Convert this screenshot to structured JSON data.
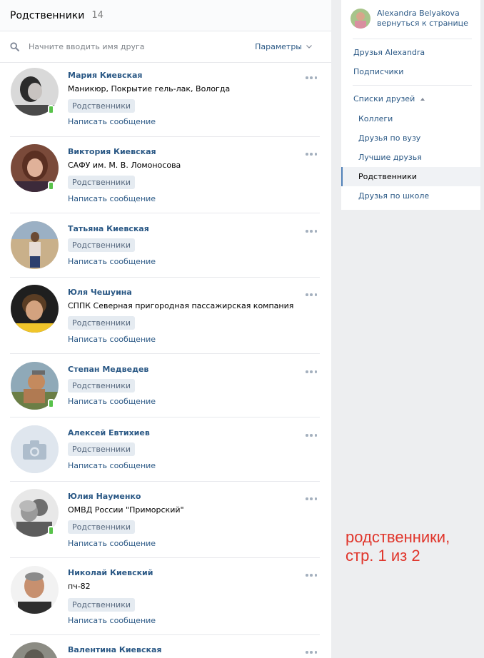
{
  "header": {
    "title": "Родственники",
    "count": "14"
  },
  "search": {
    "placeholder": "Начните вводить имя друга",
    "params_label": "Параметры"
  },
  "friends": [
    {
      "name": "Мария Киевская",
      "desc": "Маникюр, Покрытие гель-лак, Вологда",
      "tag": "Родственники",
      "msg": "Написать сообщение"
    },
    {
      "name": "Виктория Киевская",
      "desc": "САФУ им. М. В. Ломоносова",
      "tag": "Родственники",
      "msg": "Написать сообщение"
    },
    {
      "name": "Татьяна Киевская",
      "tag": "Родственники",
      "msg": "Написать сообщение"
    },
    {
      "name": "Юля Чешуина",
      "desc": "СППК Северная пригородная пассажирская компания",
      "tag": "Родственники",
      "msg": "Написать сообщение"
    },
    {
      "name": "Степан Медведев",
      "tag": "Родственники",
      "msg": "Написать сообщение"
    },
    {
      "name": "Алексей Евтихиев",
      "tag": "Родственники",
      "msg": "Написать сообщение"
    },
    {
      "name": "Юлия Науменко",
      "desc": "ОМВД России \"Приморский\"",
      "tag": "Родственники",
      "msg": "Написать сообщение"
    },
    {
      "name": "Николай Киевский",
      "desc": "пч-82",
      "tag": "Родственники",
      "msg": "Написать сообщение"
    },
    {
      "name": "Валентина Киевская"
    }
  ],
  "sidebar": {
    "user_name": "Alexandra Belyakova",
    "back_link": "вернуться к странице",
    "links": [
      "Друзья Alexandra",
      "Подписчики"
    ],
    "lists_label": "Списки друзей",
    "lists": [
      "Коллеги",
      "Друзья по вузу",
      "Лучшие друзья",
      "Родственники",
      "Друзья по школе"
    ],
    "active_list": "Родственники"
  },
  "annotation": {
    "line1": "родственники,",
    "line2": "стр. 1 из 2"
  },
  "colors": {
    "link": "#2a5885",
    "tag_bg": "#e5ebf1",
    "online_mobile": "#58c24a",
    "annotation": "#e0352b"
  }
}
